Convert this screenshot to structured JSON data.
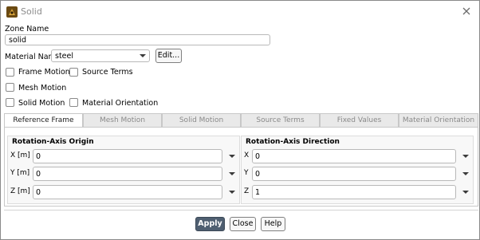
{
  "window": {
    "title": "Solid",
    "app_icon": "fluent-icon",
    "close_icon": "close-icon"
  },
  "zone": {
    "label": "Zone Name",
    "value": "solid"
  },
  "material": {
    "label": "Material Name",
    "value": "steel",
    "edit_label": "Edit..."
  },
  "checkboxes": {
    "frame_motion": "Frame Motion",
    "source_terms": "Source Terms",
    "mesh_motion": "Mesh Motion",
    "solid_motion": "Solid Motion",
    "material_orientation": "Material Orientation"
  },
  "tabs": [
    "Reference Frame",
    "Mesh Motion",
    "Solid Motion",
    "Source Terms",
    "Fixed Values",
    "Material Orientation"
  ],
  "active_tab": "Reference Frame",
  "origin": {
    "title": "Rotation-Axis Origin",
    "x_label": "X [m]",
    "x_value": "0",
    "y_label": "Y [m]",
    "y_value": "0",
    "z_label": "Z [m]",
    "z_value": "0"
  },
  "direction": {
    "title": "Rotation-Axis Direction",
    "x_label": "X",
    "x_value": "0",
    "y_label": "Y",
    "y_value": "0",
    "z_label": "Z",
    "z_value": "1"
  },
  "buttons": {
    "apply": "Apply",
    "close": "Close",
    "help": "Help"
  },
  "colors": {
    "primary_button": "#4f5f71",
    "tab_inactive_text": "#8a8a8a"
  }
}
